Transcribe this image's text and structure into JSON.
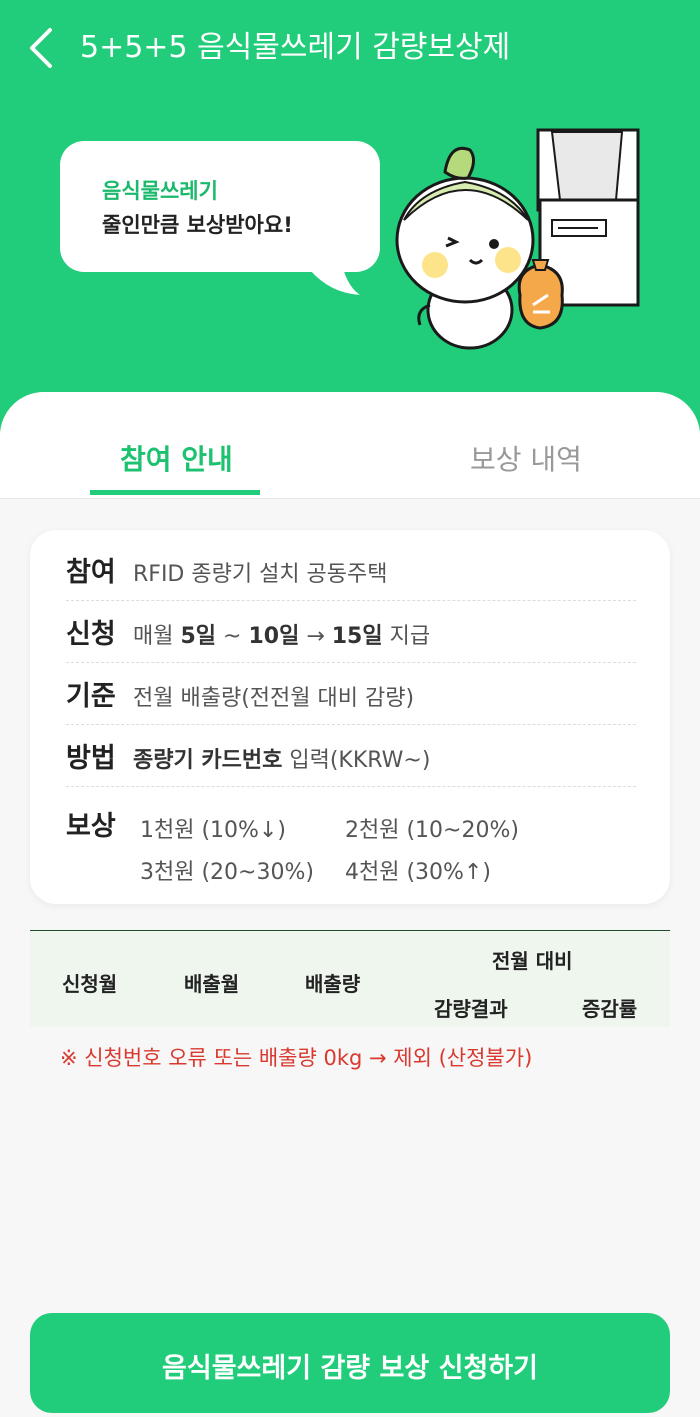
{
  "header": {
    "title": "5+5+5 음식물쓰레기 감량보상제"
  },
  "hero": {
    "bubble_line1": "음식물쓰레기",
    "bubble_line2": "줄인만큼 보상받아요!"
  },
  "tabs": [
    {
      "label": "참여 안내",
      "active": true
    },
    {
      "label": "보상 내역",
      "active": false
    }
  ],
  "info": {
    "participation": {
      "key": "참여",
      "value": "RFID 종량기 설치 공동주택"
    },
    "apply": {
      "key": "신청",
      "prefix": "매월 ",
      "start": "5일",
      "mid1": " ~ ",
      "end": "10일",
      "mid2": " → ",
      "pay": "15일",
      "suffix": " 지급"
    },
    "criteria": {
      "key": "기준",
      "value": "전월 배출량(전전월 대비 감량)"
    },
    "method": {
      "key": "방법",
      "bold": "종량기 카드번호",
      "rest": " 입력(KKRW~)"
    },
    "reward": {
      "key": "보상",
      "items": [
        "1천원 (10%↓)",
        "2천원 (10~20%)",
        "3천원 (20~30%)",
        "4천원 (30%↑)"
      ]
    }
  },
  "table": {
    "headers": {
      "month": "신청월",
      "emit_month": "배출월",
      "amount": "배출량",
      "prev_group": "전월 대비",
      "result": "감량결과",
      "rate": "증감률"
    }
  },
  "note": "※ 신청번호 오류 또는 배출량 0kg → 제외 (산정불가)",
  "cta": {
    "label": "음식물쓰레기 감량 보상 신청하기"
  },
  "colors": {
    "brand": "#21cd7a",
    "warning": "#d9392f"
  }
}
